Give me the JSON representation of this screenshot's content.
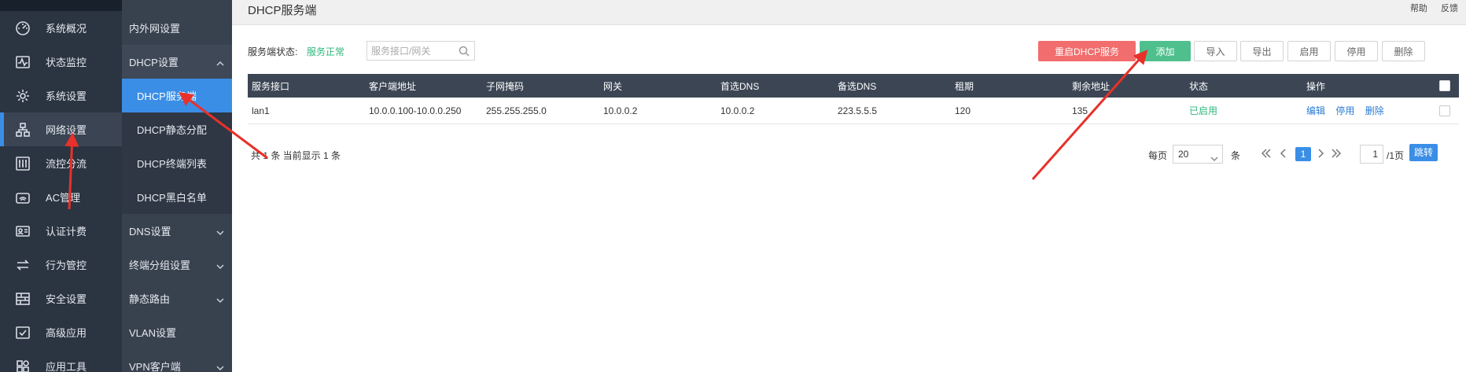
{
  "nav_primary": [
    {
      "label": "系统概况",
      "icon": "dashboard-icon"
    },
    {
      "label": "状态监控",
      "icon": "monitor-icon"
    },
    {
      "label": "系统设置",
      "icon": "gear-icon"
    },
    {
      "label": "网络设置",
      "icon": "network-icon",
      "active": true
    },
    {
      "label": "流控分流",
      "icon": "sliders-icon"
    },
    {
      "label": "AC管理",
      "icon": "wifi-router-icon"
    },
    {
      "label": "认证计费",
      "icon": "id-card-icon"
    },
    {
      "label": "行为管控",
      "icon": "swap-arrows-icon"
    },
    {
      "label": "安全设置",
      "icon": "firewall-icon"
    },
    {
      "label": "高级应用",
      "icon": "check-box-icon"
    },
    {
      "label": "应用工具",
      "icon": "apps-icon"
    }
  ],
  "nav_secondary": {
    "items": [
      {
        "label": "内外网设置"
      },
      {
        "label": "DHCP设置",
        "expanded": true
      },
      {
        "label": "DHCP服务端",
        "sub": true,
        "active": true
      },
      {
        "label": "DHCP静态分配",
        "sub": true
      },
      {
        "label": "DHCP终端列表",
        "sub": true
      },
      {
        "label": "DHCP黑白名单",
        "sub": true
      },
      {
        "label": "DNS设置",
        "collapsible": true
      },
      {
        "label": "终端分组设置",
        "collapsible": true
      },
      {
        "label": "静态路由",
        "collapsible": true
      },
      {
        "label": "VLAN设置"
      },
      {
        "label": "VPN客户端",
        "collapsible": true
      }
    ]
  },
  "header": {
    "title": "DHCP服务端",
    "help": "帮助",
    "feedback": "反馈"
  },
  "toolbar": {
    "status_label": "服务端状态:",
    "status_value": "服务正常",
    "search_placeholder": "服务接口/网关",
    "restart": "重启DHCP服务",
    "add": "添加",
    "import": "导入",
    "export": "导出",
    "enable": "启用",
    "disable": "停用",
    "delete": "删除"
  },
  "table": {
    "columns": [
      "服务接口",
      "客户端地址",
      "子网掩码",
      "网关",
      "首选DNS",
      "备选DNS",
      "租期",
      "剩余地址",
      "状态",
      "操作"
    ],
    "rows": [
      {
        "interface": "lan1",
        "client_range": "10.0.0.100-10.0.0.250",
        "netmask": "255.255.255.0",
        "gateway": "10.0.0.2",
        "dns1": "10.0.0.2",
        "dns2": "223.5.5.5",
        "lease": "120",
        "remaining": "135",
        "status": "已启用",
        "op_edit": "编辑",
        "op_disable": "停用",
        "op_delete": "删除"
      }
    ]
  },
  "footer": {
    "summary": "共 1 条 当前显示 1 条",
    "per_page_label": "每页",
    "per_page_value": "20",
    "per_page_unit": "条",
    "current_page": "1",
    "page_input": "1",
    "total_pages": "/1页",
    "jump": "跳转"
  },
  "colors": {
    "nav_primary_bg": "#2b3441",
    "nav_secondary_bg": "#38414e",
    "accent_blue": "#3a8ee6",
    "add_green": "#4fc08d",
    "restart_red": "#f26d6d",
    "status_green": "#2db77a",
    "annotation_red": "#e8312a"
  }
}
